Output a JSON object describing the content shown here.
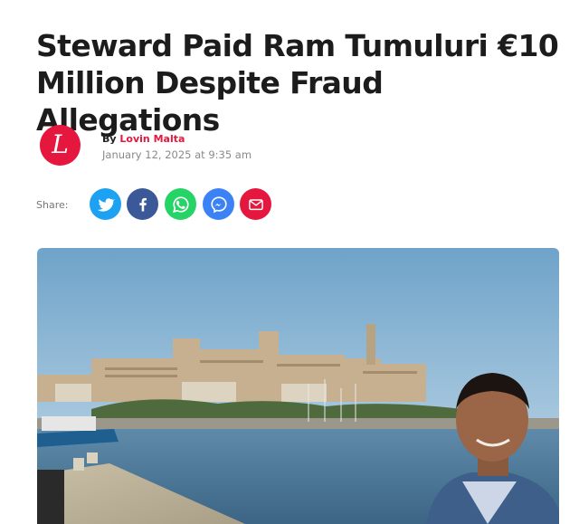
{
  "article": {
    "headline_line1": "Steward Paid Ram Tumuluri €10",
    "headline_line2": "Million Despite Fraud Allegations",
    "by_prefix": "By",
    "author": "Lovin Malta",
    "date": "January 12, 2025 at 9:35 am",
    "avatar_letter": "L"
  },
  "share": {
    "label": "Share:",
    "buttons": [
      {
        "icon": "twitter-icon",
        "color": "#1da1f2"
      },
      {
        "icon": "facebook-icon",
        "color": "#3b5998"
      },
      {
        "icon": "whatsapp-icon",
        "color": "#25d366"
      },
      {
        "icon": "messenger-icon",
        "color": "#3b82f6"
      },
      {
        "icon": "email-icon",
        "color": "#e5173f"
      }
    ]
  },
  "colors": {
    "brand": "#e5173f",
    "headline": "#1c1c1c"
  }
}
